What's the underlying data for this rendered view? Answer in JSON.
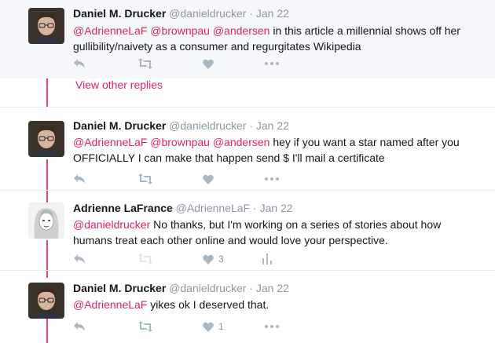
{
  "colors": {
    "mention": "#e0245e",
    "thread_line": "#e0245e",
    "action_icon": "#aab8c2",
    "meta": "#8899a6",
    "highlight_bg": "#f5f8fa"
  },
  "view_other_replies": "View other replies",
  "tweets": [
    {
      "name": "Daniel M. Drucker",
      "handle": "@danieldrucker",
      "dot": "·",
      "time": "Jan 22",
      "mentions": "@AdrienneLaF @brownpau @andersen",
      "body_line1": " in this article a millennial shows off her",
      "body_line2": "gullibility/naivety as a consumer and regurgitates Wikipedia",
      "like_count": "",
      "avatar": "avatar-daniel"
    },
    {
      "name": "Daniel M. Drucker",
      "handle": "@danieldrucker",
      "dot": "·",
      "time": "Jan 22",
      "mentions": "@AdrienneLaF @brownpau @andersen",
      "body_line1": " hey if you want a star named after you",
      "body_line2": "OFFICIALLY I can make that happen send $ I'll mail a certificate",
      "like_count": "",
      "avatar": "avatar-daniel"
    },
    {
      "name": "Adrienne LaFrance",
      "handle": "@AdrienneLaF",
      "dot": "·",
      "time": "Jan 22",
      "mentions": "@danieldrucker",
      "body_line1": " No thanks, but I'm working on a series of stories about how",
      "body_line2": "humans treat each other online and would love your perspective.",
      "like_count": "3",
      "avatar": "avatar-adrienne"
    },
    {
      "name": "Daniel M. Drucker",
      "handle": "@danieldrucker",
      "dot": "·",
      "time": "Jan 22",
      "mentions": "@AdrienneLaF",
      "body_line1": " yikes ok I deserved that.",
      "body_line2": "",
      "like_count": "1",
      "avatar": "avatar-daniel"
    }
  ]
}
